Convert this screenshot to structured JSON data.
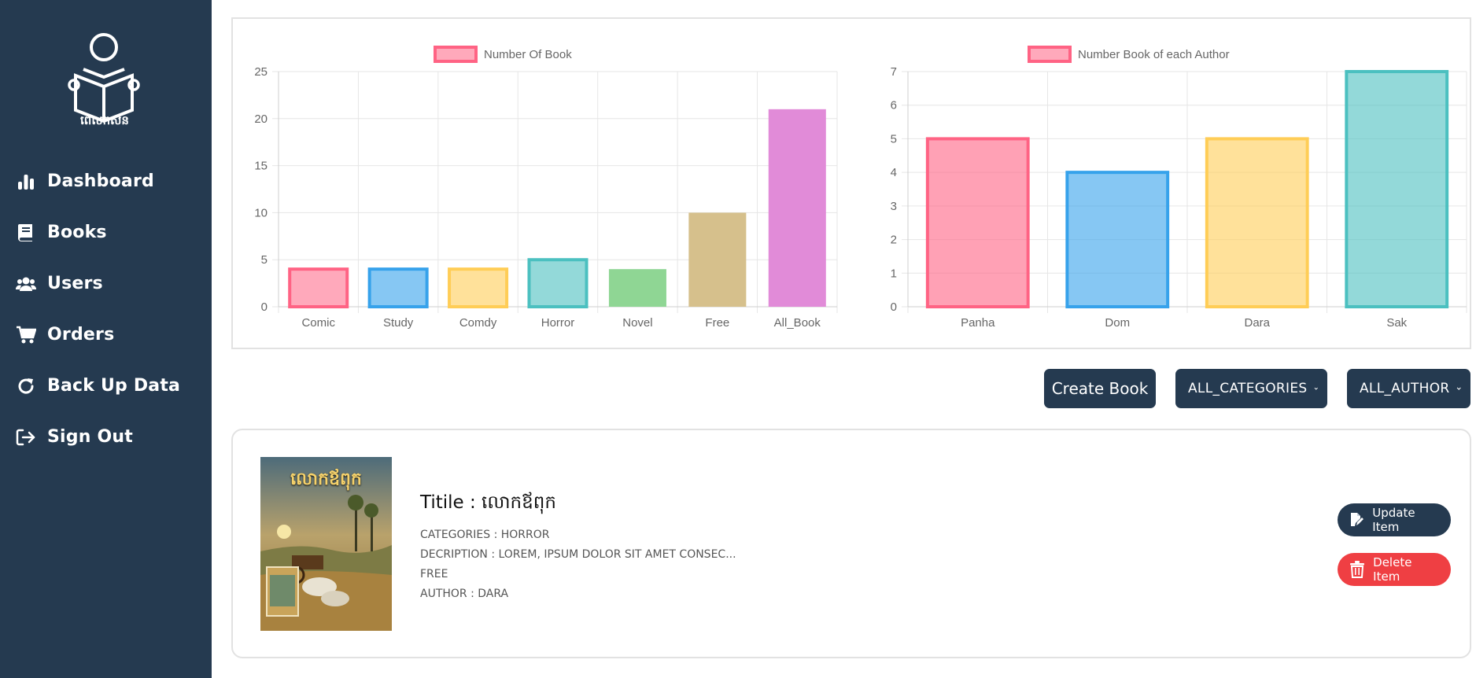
{
  "sidebar": {
    "items": [
      {
        "label": "Dashboard",
        "icon": "bar-chart-icon"
      },
      {
        "label": "Books",
        "icon": "book-icon"
      },
      {
        "label": "Users",
        "icon": "users-icon"
      },
      {
        "label": "Orders",
        "icon": "cart-icon"
      },
      {
        "label": "Back Up Data",
        "icon": "refresh-icon"
      },
      {
        "label": "Sign Out",
        "icon": "sign-out-icon"
      }
    ],
    "logo_text": "ពេលកសន"
  },
  "colors": {
    "sidebar_bg": "#253a50",
    "delete": "#ef3f43",
    "pink": "#ff6384",
    "blue": "#36a2eb",
    "yellow": "#ffcd56",
    "teal": "#4bc0c0",
    "green": "#8fd694",
    "tan": "#d6c08c",
    "purple": "#e18bd8"
  },
  "chart_data": [
    {
      "type": "bar",
      "legend": "Number Of Book",
      "categories": [
        "Comic",
        "Study",
        "Comdy",
        "Horror",
        "Novel",
        "Free",
        "All_Book"
      ],
      "values": [
        4,
        4,
        4,
        5,
        4,
        10,
        21
      ],
      "ylim": [
        0,
        25
      ],
      "yticks": [
        0,
        5,
        10,
        15,
        20,
        25
      ],
      "grid": true,
      "legend_position": "top"
    },
    {
      "type": "bar",
      "legend": "Number Book of each Author",
      "categories": [
        "Panha",
        "Dom",
        "Dara",
        "Sak"
      ],
      "values": [
        5,
        4,
        5,
        7
      ],
      "ylim": [
        0,
        7
      ],
      "yticks": [
        0,
        1,
        2,
        3,
        4,
        5,
        6,
        7
      ],
      "grid": true,
      "legend_position": "top"
    }
  ],
  "toolbar": {
    "create_label": "Create Book",
    "category_select": "ALL_CATEGORIES",
    "author_select": "ALL_AUTHOR"
  },
  "book": {
    "title": "Titile : លោកឪពុក",
    "category": "CATEGORIES : HORROR",
    "description": "DECRIPTION : LOREM, IPSUM DOLOR SIT AMET CONSEC...",
    "price": "FREE",
    "author": "AUTHOR : DARA",
    "cover_title": "លោកឪពុក",
    "update_label": "Update Item",
    "delete_label": "Delete Item"
  }
}
